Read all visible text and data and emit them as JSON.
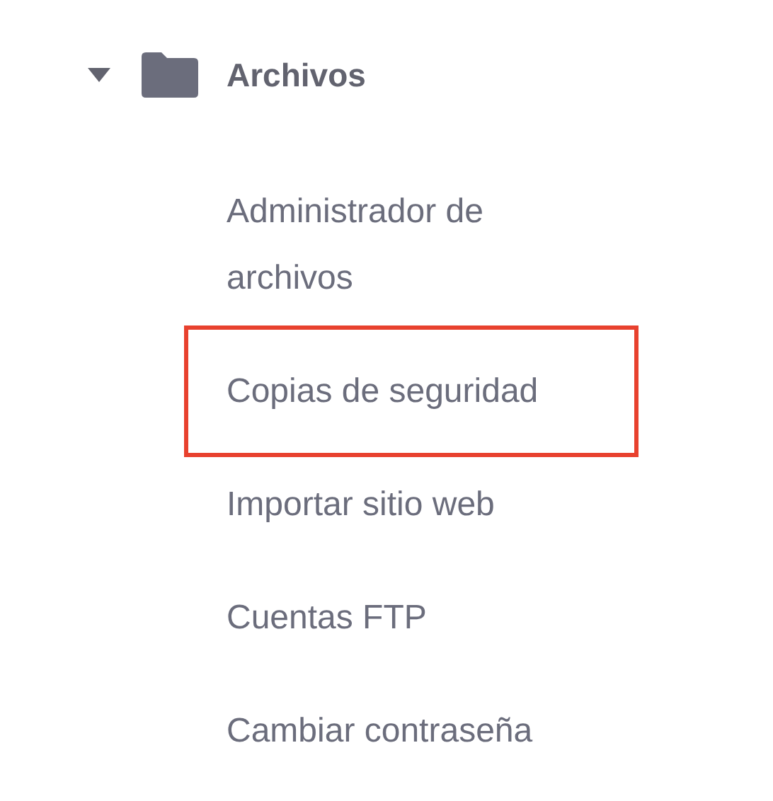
{
  "section": {
    "title": "Archivos",
    "expanded": true
  },
  "items": [
    {
      "label": "Administrador de archivos",
      "highlighted": false
    },
    {
      "label": "Copias de seguridad",
      "highlighted": true
    },
    {
      "label": "Importar sitio web",
      "highlighted": false
    },
    {
      "label": "Cuentas FTP",
      "highlighted": false
    },
    {
      "label": "Cambiar contraseña",
      "highlighted": false
    }
  ]
}
